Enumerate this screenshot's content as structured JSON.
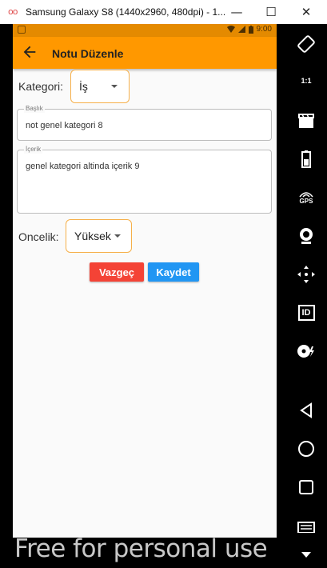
{
  "window": {
    "title": "Samsung Galaxy S8 (1440x2960, 480dpi) - 1...",
    "logo": "oo",
    "minimize": "—",
    "maximize": "☐",
    "close": "✕"
  },
  "statusbar": {
    "time": "9:00"
  },
  "appbar": {
    "title": "Notu Düzenle"
  },
  "form": {
    "category_label": "Kategori:",
    "category_value": "İş",
    "title_field": {
      "label": "Başlık",
      "value": "not genel kategori 8"
    },
    "content_field": {
      "label": "İçerik",
      "value": "genel kategori altinda içerik 9"
    },
    "priority_label": "Oncelik:",
    "priority_value": "Yüksek"
  },
  "buttons": {
    "cancel_label": "Vazgeç",
    "save_label": "Kaydet"
  },
  "colors": {
    "appbar": "#ff9800",
    "statusbar": "#e48a00",
    "cancel": "#f44336",
    "save": "#2196f3",
    "dropdown_border": "#f6b04b"
  },
  "toolbar": {
    "icons": [
      "rotate-icon",
      "one-to-one-icon",
      "screen-record-icon",
      "battery-icon",
      "gps-icon",
      "webcam-icon",
      "move-icon",
      "id-icon",
      "disk-icon",
      "back-icon",
      "home-icon",
      "recents-icon",
      "menu-icon",
      "more-icon"
    ],
    "gps_text": "GPS",
    "id_text": "ID",
    "one_to_one_text": "1:1"
  },
  "watermark": "Free for personal use"
}
